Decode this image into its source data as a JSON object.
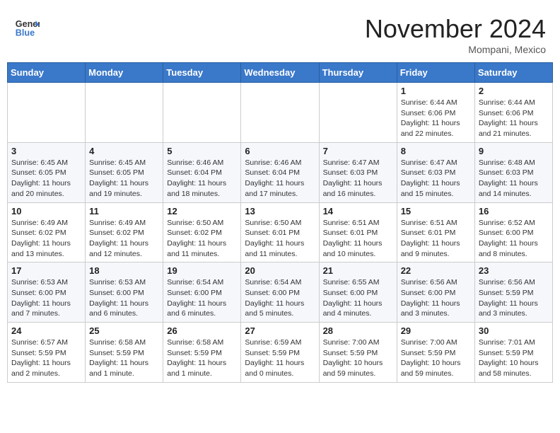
{
  "header": {
    "logo_line1": "General",
    "logo_line2": "Blue",
    "month": "November 2024",
    "location": "Mompani, Mexico"
  },
  "weekdays": [
    "Sunday",
    "Monday",
    "Tuesday",
    "Wednesday",
    "Thursday",
    "Friday",
    "Saturday"
  ],
  "weeks": [
    [
      {
        "day": "",
        "sunrise": "",
        "sunset": "",
        "daylight": ""
      },
      {
        "day": "",
        "sunrise": "",
        "sunset": "",
        "daylight": ""
      },
      {
        "day": "",
        "sunrise": "",
        "sunset": "",
        "daylight": ""
      },
      {
        "day": "",
        "sunrise": "",
        "sunset": "",
        "daylight": ""
      },
      {
        "day": "",
        "sunrise": "",
        "sunset": "",
        "daylight": ""
      },
      {
        "day": "1",
        "sunrise": "Sunrise: 6:44 AM",
        "sunset": "Sunset: 6:06 PM",
        "daylight": "Daylight: 11 hours and 22 minutes."
      },
      {
        "day": "2",
        "sunrise": "Sunrise: 6:44 AM",
        "sunset": "Sunset: 6:06 PM",
        "daylight": "Daylight: 11 hours and 21 minutes."
      }
    ],
    [
      {
        "day": "3",
        "sunrise": "Sunrise: 6:45 AM",
        "sunset": "Sunset: 6:05 PM",
        "daylight": "Daylight: 11 hours and 20 minutes."
      },
      {
        "day": "4",
        "sunrise": "Sunrise: 6:45 AM",
        "sunset": "Sunset: 6:05 PM",
        "daylight": "Daylight: 11 hours and 19 minutes."
      },
      {
        "day": "5",
        "sunrise": "Sunrise: 6:46 AM",
        "sunset": "Sunset: 6:04 PM",
        "daylight": "Daylight: 11 hours and 18 minutes."
      },
      {
        "day": "6",
        "sunrise": "Sunrise: 6:46 AM",
        "sunset": "Sunset: 6:04 PM",
        "daylight": "Daylight: 11 hours and 17 minutes."
      },
      {
        "day": "7",
        "sunrise": "Sunrise: 6:47 AM",
        "sunset": "Sunset: 6:03 PM",
        "daylight": "Daylight: 11 hours and 16 minutes."
      },
      {
        "day": "8",
        "sunrise": "Sunrise: 6:47 AM",
        "sunset": "Sunset: 6:03 PM",
        "daylight": "Daylight: 11 hours and 15 minutes."
      },
      {
        "day": "9",
        "sunrise": "Sunrise: 6:48 AM",
        "sunset": "Sunset: 6:03 PM",
        "daylight": "Daylight: 11 hours and 14 minutes."
      }
    ],
    [
      {
        "day": "10",
        "sunrise": "Sunrise: 6:49 AM",
        "sunset": "Sunset: 6:02 PM",
        "daylight": "Daylight: 11 hours and 13 minutes."
      },
      {
        "day": "11",
        "sunrise": "Sunrise: 6:49 AM",
        "sunset": "Sunset: 6:02 PM",
        "daylight": "Daylight: 11 hours and 12 minutes."
      },
      {
        "day": "12",
        "sunrise": "Sunrise: 6:50 AM",
        "sunset": "Sunset: 6:02 PM",
        "daylight": "Daylight: 11 hours and 11 minutes."
      },
      {
        "day": "13",
        "sunrise": "Sunrise: 6:50 AM",
        "sunset": "Sunset: 6:01 PM",
        "daylight": "Daylight: 11 hours and 11 minutes."
      },
      {
        "day": "14",
        "sunrise": "Sunrise: 6:51 AM",
        "sunset": "Sunset: 6:01 PM",
        "daylight": "Daylight: 11 hours and 10 minutes."
      },
      {
        "day": "15",
        "sunrise": "Sunrise: 6:51 AM",
        "sunset": "Sunset: 6:01 PM",
        "daylight": "Daylight: 11 hours and 9 minutes."
      },
      {
        "day": "16",
        "sunrise": "Sunrise: 6:52 AM",
        "sunset": "Sunset: 6:00 PM",
        "daylight": "Daylight: 11 hours and 8 minutes."
      }
    ],
    [
      {
        "day": "17",
        "sunrise": "Sunrise: 6:53 AM",
        "sunset": "Sunset: 6:00 PM",
        "daylight": "Daylight: 11 hours and 7 minutes."
      },
      {
        "day": "18",
        "sunrise": "Sunrise: 6:53 AM",
        "sunset": "Sunset: 6:00 PM",
        "daylight": "Daylight: 11 hours and 6 minutes."
      },
      {
        "day": "19",
        "sunrise": "Sunrise: 6:54 AM",
        "sunset": "Sunset: 6:00 PM",
        "daylight": "Daylight: 11 hours and 6 minutes."
      },
      {
        "day": "20",
        "sunrise": "Sunrise: 6:54 AM",
        "sunset": "Sunset: 6:00 PM",
        "daylight": "Daylight: 11 hours and 5 minutes."
      },
      {
        "day": "21",
        "sunrise": "Sunrise: 6:55 AM",
        "sunset": "Sunset: 6:00 PM",
        "daylight": "Daylight: 11 hours and 4 minutes."
      },
      {
        "day": "22",
        "sunrise": "Sunrise: 6:56 AM",
        "sunset": "Sunset: 6:00 PM",
        "daylight": "Daylight: 11 hours and 3 minutes."
      },
      {
        "day": "23",
        "sunrise": "Sunrise: 6:56 AM",
        "sunset": "Sunset: 5:59 PM",
        "daylight": "Daylight: 11 hours and 3 minutes."
      }
    ],
    [
      {
        "day": "24",
        "sunrise": "Sunrise: 6:57 AM",
        "sunset": "Sunset: 5:59 PM",
        "daylight": "Daylight: 11 hours and 2 minutes."
      },
      {
        "day": "25",
        "sunrise": "Sunrise: 6:58 AM",
        "sunset": "Sunset: 5:59 PM",
        "daylight": "Daylight: 11 hours and 1 minute."
      },
      {
        "day": "26",
        "sunrise": "Sunrise: 6:58 AM",
        "sunset": "Sunset: 5:59 PM",
        "daylight": "Daylight: 11 hours and 1 minute."
      },
      {
        "day": "27",
        "sunrise": "Sunrise: 6:59 AM",
        "sunset": "Sunset: 5:59 PM",
        "daylight": "Daylight: 11 hours and 0 minutes."
      },
      {
        "day": "28",
        "sunrise": "Sunrise: 7:00 AM",
        "sunset": "Sunset: 5:59 PM",
        "daylight": "Daylight: 10 hours and 59 minutes."
      },
      {
        "day": "29",
        "sunrise": "Sunrise: 7:00 AM",
        "sunset": "Sunset: 5:59 PM",
        "daylight": "Daylight: 10 hours and 59 minutes."
      },
      {
        "day": "30",
        "sunrise": "Sunrise: 7:01 AM",
        "sunset": "Sunset: 5:59 PM",
        "daylight": "Daylight: 10 hours and 58 minutes."
      }
    ]
  ]
}
